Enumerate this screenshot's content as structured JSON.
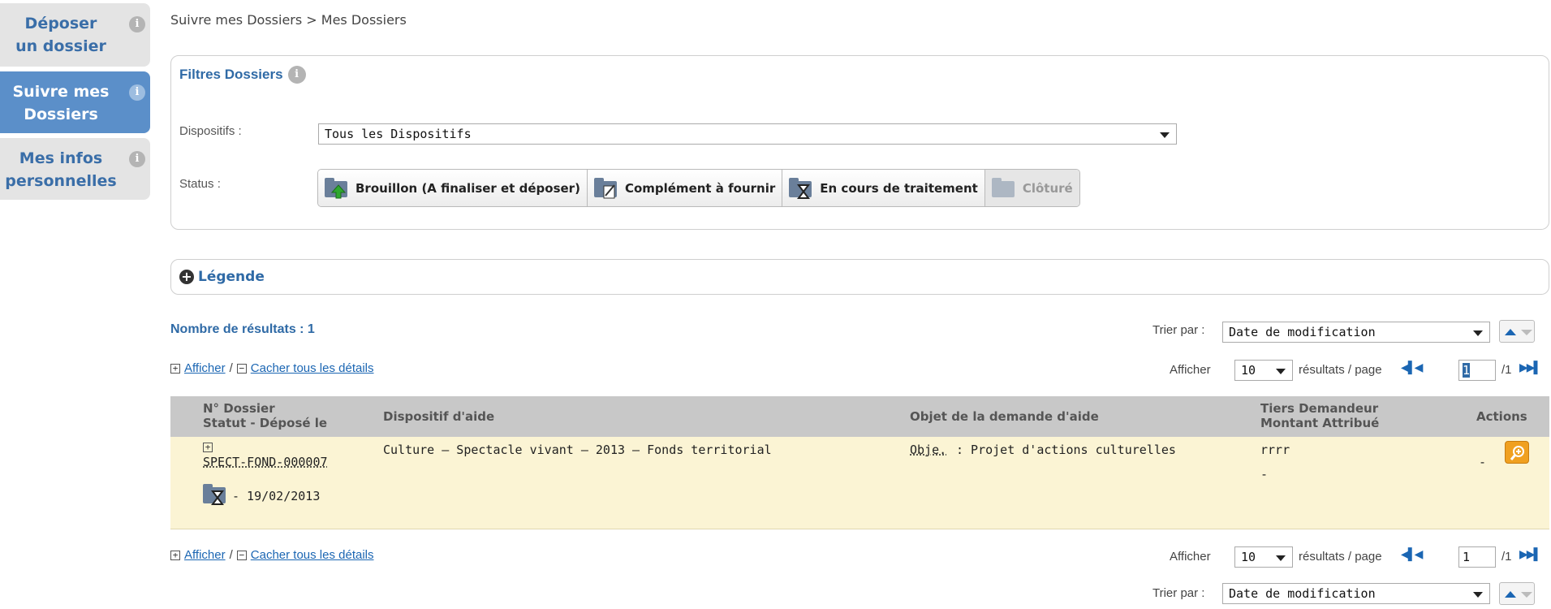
{
  "sidebar": {
    "items": [
      {
        "label_line1": "Déposer",
        "label_line2": "un dossier",
        "info": "i"
      },
      {
        "label_line1": "Suivre mes",
        "label_line2": "Dossiers",
        "info": "i"
      },
      {
        "label_line1": "Mes infos",
        "label_line2": "personnelles",
        "info": "i"
      }
    ]
  },
  "breadcrumb": "Suivre mes Dossiers > Mes Dossiers",
  "filters": {
    "title": "Filtres Dossiers",
    "info": "i",
    "dispositifs_label": "Dispositifs :",
    "dispositifs_value": "Tous les Dispositifs",
    "status_label": "Status :",
    "status_buttons": [
      "Brouillon (A finaliser et déposer)",
      "Complément à fournir",
      "En cours de traitement",
      "Clôturé"
    ]
  },
  "legend": {
    "label": "Légende",
    "toggle": "+"
  },
  "results": {
    "count_label": "Nombre de résultats : 1",
    "sort_label": "Trier par :",
    "sort_value": "Date de modification",
    "show_all": "Afficher",
    "separator": "/",
    "hide_all": "Cacher tous les détails",
    "per_page_prefix": "Afficher",
    "per_page_value": "10",
    "per_page_suffix": "résultats / page",
    "page_value": "1",
    "page_total": "/1"
  },
  "table": {
    "headers": {
      "col1_line1": "N° Dossier",
      "col1_line2": "Statut - Déposé le",
      "col2": "Dispositif d'aide",
      "col3": "Objet de la demande d'aide",
      "col4_line1": "Tiers Demandeur",
      "col4_line2": "Montant Attribué",
      "col5": "Actions"
    },
    "rows": [
      {
        "expand": "+",
        "dossier": "SPECT-FOND-000007",
        "date": "- 19/02/2013",
        "dispositif": "Culture – Spectacle vivant – 2013 – Fonds territorial",
        "objet_abbr": "Obje.",
        "objet_text": ": Projet d'actions culturelles",
        "tiers": "rrrr",
        "montant": "-",
        "actions_dash": "-"
      }
    ]
  },
  "colors": {
    "accent": "#2f6aa6",
    "sidebar_active": "#5b8fc9",
    "row_bg": "#fbf4d4",
    "header_bg": "#c8c8c8",
    "action_btn": "#f0a020"
  }
}
